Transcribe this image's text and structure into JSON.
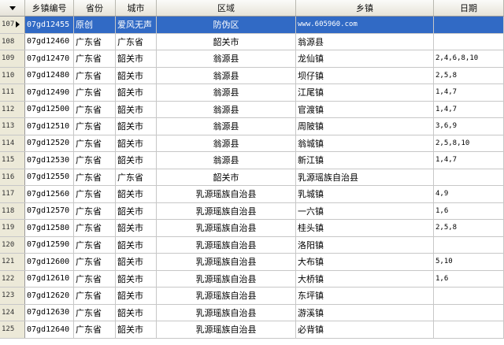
{
  "headers": [
    "乡镇编号",
    "省份",
    "城市",
    "区域",
    "乡镇",
    "日期"
  ],
  "rows": [
    {
      "num": "107",
      "code": "07gd12455",
      "prov": "原创",
      "city": "爱风无声",
      "area": "防伪区",
      "town": "www.605960.com",
      "date": "",
      "selected": true
    },
    {
      "num": "108",
      "code": "07gd12460",
      "prov": "广东省",
      "city": "广东省",
      "area": "韶关市",
      "town": "翁源县",
      "date": ""
    },
    {
      "num": "109",
      "code": "07gd12470",
      "prov": "广东省",
      "city": "韶关市",
      "area": "翁源县",
      "town": "龙仙镇",
      "date": "2,4,6,8,10"
    },
    {
      "num": "110",
      "code": "07gd12480",
      "prov": "广东省",
      "city": "韶关市",
      "area": "翁源县",
      "town": "坝仔镇",
      "date": "2,5,8"
    },
    {
      "num": "111",
      "code": "07gd12490",
      "prov": "广东省",
      "city": "韶关市",
      "area": "翁源县",
      "town": "江尾镇",
      "date": "1,4,7"
    },
    {
      "num": "112",
      "code": "07gd12500",
      "prov": "广东省",
      "city": "韶关市",
      "area": "翁源县",
      "town": "官渡镇",
      "date": "1,4,7"
    },
    {
      "num": "113",
      "code": "07gd12510",
      "prov": "广东省",
      "city": "韶关市",
      "area": "翁源县",
      "town": "周陂镇",
      "date": "3,6,9"
    },
    {
      "num": "114",
      "code": "07gd12520",
      "prov": "广东省",
      "city": "韶关市",
      "area": "翁源县",
      "town": "翁城镇",
      "date": "2,5,8,10"
    },
    {
      "num": "115",
      "code": "07gd12530",
      "prov": "广东省",
      "city": "韶关市",
      "area": "翁源县",
      "town": "新江镇",
      "date": "1,4,7"
    },
    {
      "num": "116",
      "code": "07gd12550",
      "prov": "广东省",
      "city": "广东省",
      "area": "韶关市",
      "town": "乳源瑶族自治县",
      "date": ""
    },
    {
      "num": "117",
      "code": "07gd12560",
      "prov": "广东省",
      "city": "韶关市",
      "area": "乳源瑶族自治县",
      "town": "乳城镇",
      "date": "4,9"
    },
    {
      "num": "118",
      "code": "07gd12570",
      "prov": "广东省",
      "city": "韶关市",
      "area": "乳源瑶族自治县",
      "town": "一六镇",
      "date": "1,6"
    },
    {
      "num": "119",
      "code": "07gd12580",
      "prov": "广东省",
      "city": "韶关市",
      "area": "乳源瑶族自治县",
      "town": "桂头镇",
      "date": "2,5,8"
    },
    {
      "num": "120",
      "code": "07gd12590",
      "prov": "广东省",
      "city": "韶关市",
      "area": "乳源瑶族自治县",
      "town": "洛阳镇",
      "date": ""
    },
    {
      "num": "121",
      "code": "07gd12600",
      "prov": "广东省",
      "city": "韶关市",
      "area": "乳源瑶族自治县",
      "town": "大布镇",
      "date": "5,10"
    },
    {
      "num": "122",
      "code": "07gd12610",
      "prov": "广东省",
      "city": "韶关市",
      "area": "乳源瑶族自治县",
      "town": "大桥镇",
      "date": "1,6"
    },
    {
      "num": "123",
      "code": "07gd12620",
      "prov": "广东省",
      "city": "韶关市",
      "area": "乳源瑶族自治县",
      "town": "东坪镇",
      "date": ""
    },
    {
      "num": "124",
      "code": "07gd12630",
      "prov": "广东省",
      "city": "韶关市",
      "area": "乳源瑶族自治县",
      "town": "游溪镇",
      "date": ""
    },
    {
      "num": "125",
      "code": "07gd12640",
      "prov": "广东省",
      "city": "韶关市",
      "area": "乳源瑶族自治县",
      "town": "必背镇",
      "date": ""
    }
  ]
}
